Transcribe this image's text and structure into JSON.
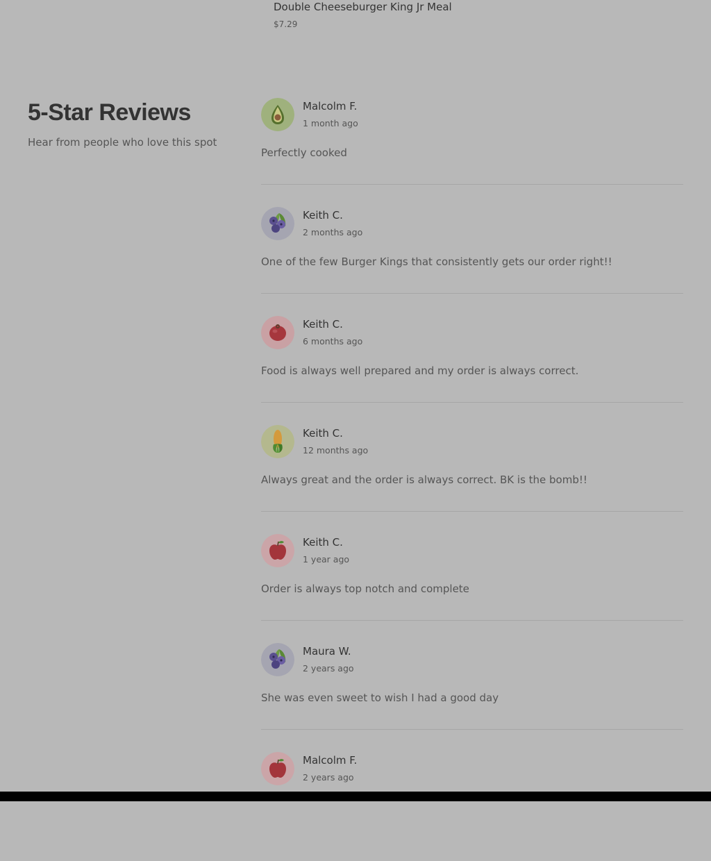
{
  "featured_item": {
    "name": "Double Cheeseburger King Jr Meal",
    "price": "$7.29"
  },
  "reviews_section": {
    "title": "5-Star Reviews",
    "subtitle": "Hear from people who love this spot",
    "reviews": [
      {
        "name": "Malcolm F.",
        "time": "1 month ago",
        "text": "Perfectly cooked",
        "avatar": "avocado-icon"
      },
      {
        "name": "Keith C.",
        "time": "2 months ago",
        "text": "One of the few Burger Kings that consistently gets our order right!!",
        "avatar": "blueberries-icon"
      },
      {
        "name": "Keith C.",
        "time": "6 months ago",
        "text": "Food is always well prepared and my order is always correct.",
        "avatar": "tomato-icon"
      },
      {
        "name": "Keith C.",
        "time": "12 months ago",
        "text": "Always great and the order is always correct. BK is the bomb!!",
        "avatar": "corn-icon"
      },
      {
        "name": "Keith C.",
        "time": "1 year ago",
        "text": "Order is always top notch and complete",
        "avatar": "apple-icon"
      },
      {
        "name": "Maura W.",
        "time": "2 years ago",
        "text": "She was even sweet to wish I had a good day",
        "avatar": "blueberries-icon"
      },
      {
        "name": "Malcolm F.",
        "time": "2 years ago",
        "text": "",
        "avatar": "apple-icon"
      }
    ]
  }
}
